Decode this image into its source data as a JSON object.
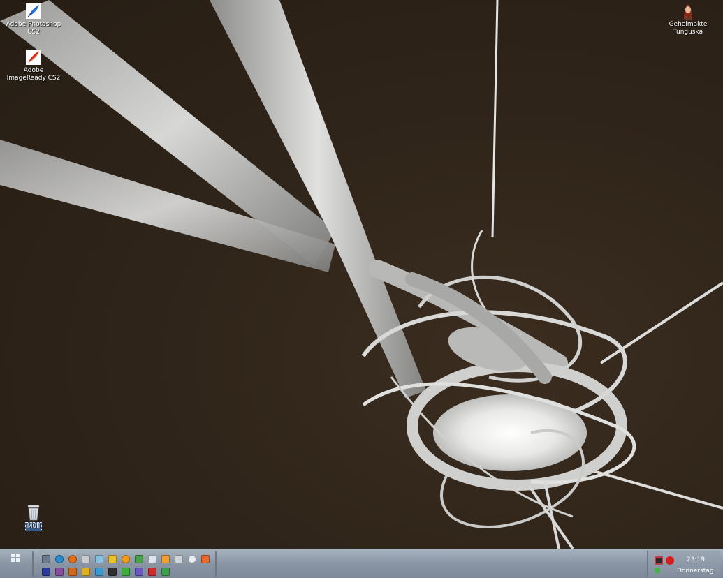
{
  "desktop": {
    "icons": [
      {
        "name": "photoshop",
        "label": "Adobe Photoshop\nCS2",
        "icon": "photoshop-feather-icon"
      },
      {
        "name": "imageready",
        "label": "Adobe\nImageReady CS2",
        "icon": "imageready-feather-icon"
      },
      {
        "name": "tunguska",
        "label": "Geheimakte\nTunguska",
        "icon": "game-character-icon"
      },
      {
        "name": "trash",
        "label": "Müll",
        "icon": "trash-bin-icon"
      }
    ]
  },
  "taskbar": {
    "start_icon": "start-menu-grid-icon",
    "quick_launch": [
      "camera-icon",
      "globe-icon",
      "firefox-icon",
      "printer-icon",
      "jar-icon",
      "keys-icon",
      "info-icon",
      "recycle-icon",
      "document-icon",
      "search-icon",
      "tools-icon",
      "disc-icon",
      "paint-icon",
      "floppy-icon",
      "stack-icon",
      "fire-icon",
      "wand-icon",
      "palette-icon",
      "film-icon",
      "puzzle-icon",
      "pad-icon",
      "calendar-icon",
      "arrow-icon"
    ],
    "tray": {
      "icons": [
        "monitor-icon",
        "record-icon",
        "network-icon"
      ],
      "time": "23:19",
      "day": "Donnerstag"
    }
  },
  "colors": {
    "wallpaper_bg": "#2e2318",
    "taskbar": "#8a96a4"
  }
}
